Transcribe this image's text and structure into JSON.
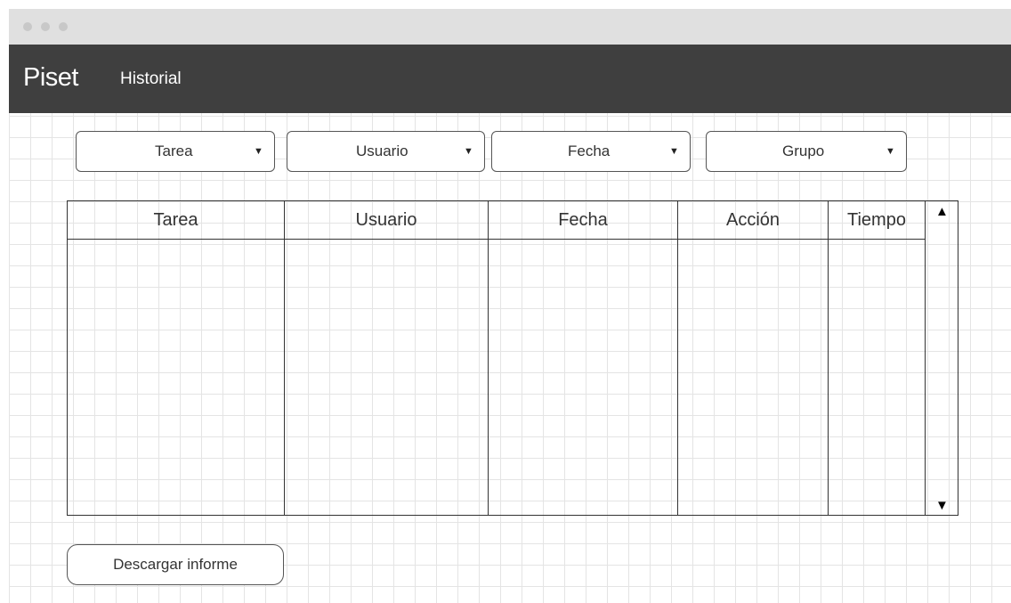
{
  "app": {
    "brand": "Piset",
    "nav": {
      "historial": "Historial"
    }
  },
  "filters": [
    {
      "label": "Tarea",
      "icon": "dropdown-arrow-icon"
    },
    {
      "label": "Usuario",
      "icon": "dropdown-arrow-icon"
    },
    {
      "label": "Fecha",
      "icon": "dropdown-arrow-icon"
    },
    {
      "label": "Grupo",
      "icon": "dropdown-arrow-icon"
    }
  ],
  "table": {
    "columns": [
      "Tarea",
      "Usuario",
      "Fecha",
      "Acción",
      "Tiempo"
    ],
    "rows": [],
    "scroll_up_glyph": "▲",
    "scroll_down_glyph": "▼"
  },
  "actions": {
    "download_label": "Descargar informe"
  },
  "glyphs": {
    "dropdown": "▼"
  }
}
